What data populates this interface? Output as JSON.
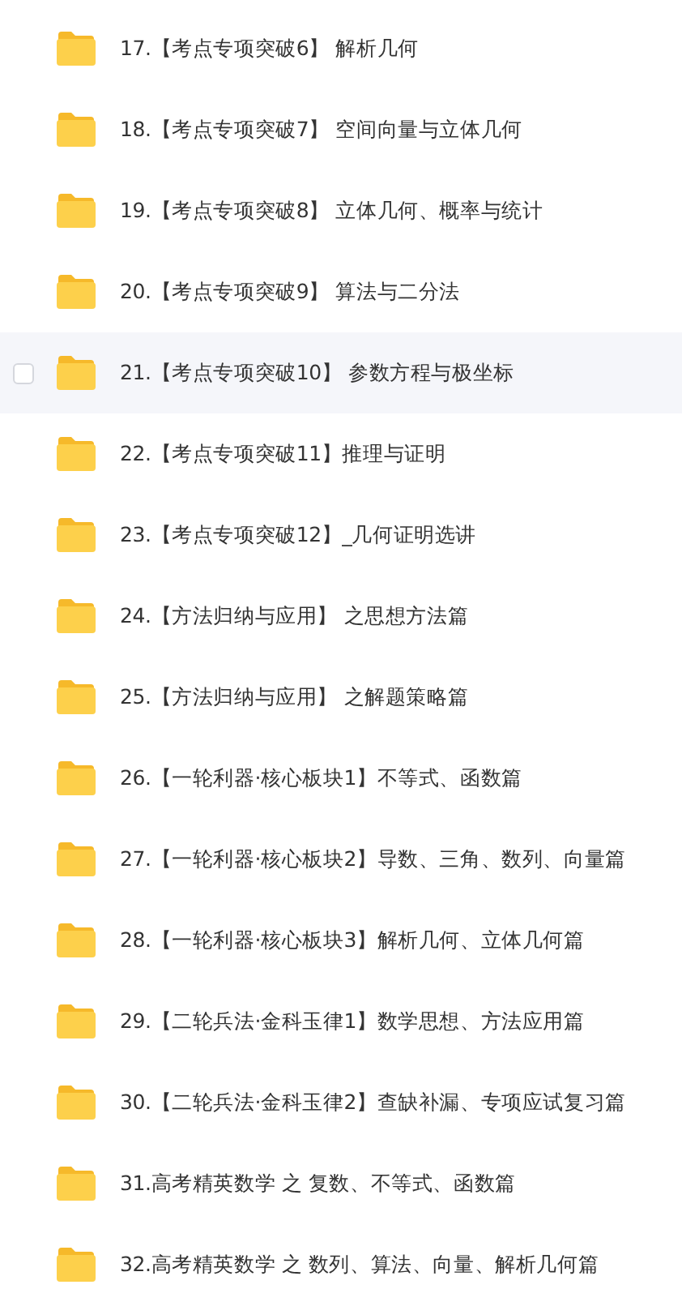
{
  "files": [
    {
      "name": "17.【考点专项突破6】 解析几何",
      "hovered": false,
      "checked": false
    },
    {
      "name": "18.【考点专项突破7】 空间向量与立体几何",
      "hovered": false,
      "checked": false
    },
    {
      "name": "19.【考点专项突破8】 立体几何、概率与统计",
      "hovered": false,
      "checked": false
    },
    {
      "name": "20.【考点专项突破9】 算法与二分法",
      "hovered": false,
      "checked": false
    },
    {
      "name": "21.【考点专项突破10】 参数方程与极坐标",
      "hovered": true,
      "checked": false
    },
    {
      "name": "22.【考点专项突破11】推理与证明",
      "hovered": false,
      "checked": false
    },
    {
      "name": "23.【考点专项突破12】_几何证明选讲",
      "hovered": false,
      "checked": false
    },
    {
      "name": "24.【方法归纳与应用】 之思想方法篇",
      "hovered": false,
      "checked": false
    },
    {
      "name": "25.【方法归纳与应用】 之解题策略篇",
      "hovered": false,
      "checked": false
    },
    {
      "name": "26.【一轮利器·核心板块1】不等式、函数篇",
      "hovered": false,
      "checked": false
    },
    {
      "name": "27.【一轮利器·核心板块2】导数、三角、数列、向量篇",
      "hovered": false,
      "checked": false
    },
    {
      "name": "28.【一轮利器·核心板块3】解析几何、立体几何篇",
      "hovered": false,
      "checked": false
    },
    {
      "name": "29.【二轮兵法·金科玉律1】数学思想、方法应用篇",
      "hovered": false,
      "checked": false
    },
    {
      "name": "30.【二轮兵法·金科玉律2】查缺补漏、专项应试复习篇",
      "hovered": false,
      "checked": false
    },
    {
      "name": "31.高考精英数学 之 复数、不等式、函数篇",
      "hovered": false,
      "checked": false
    },
    {
      "name": "32.高考精英数学 之 数列、算法、向量、解析几何篇",
      "hovered": false,
      "checked": false
    }
  ]
}
